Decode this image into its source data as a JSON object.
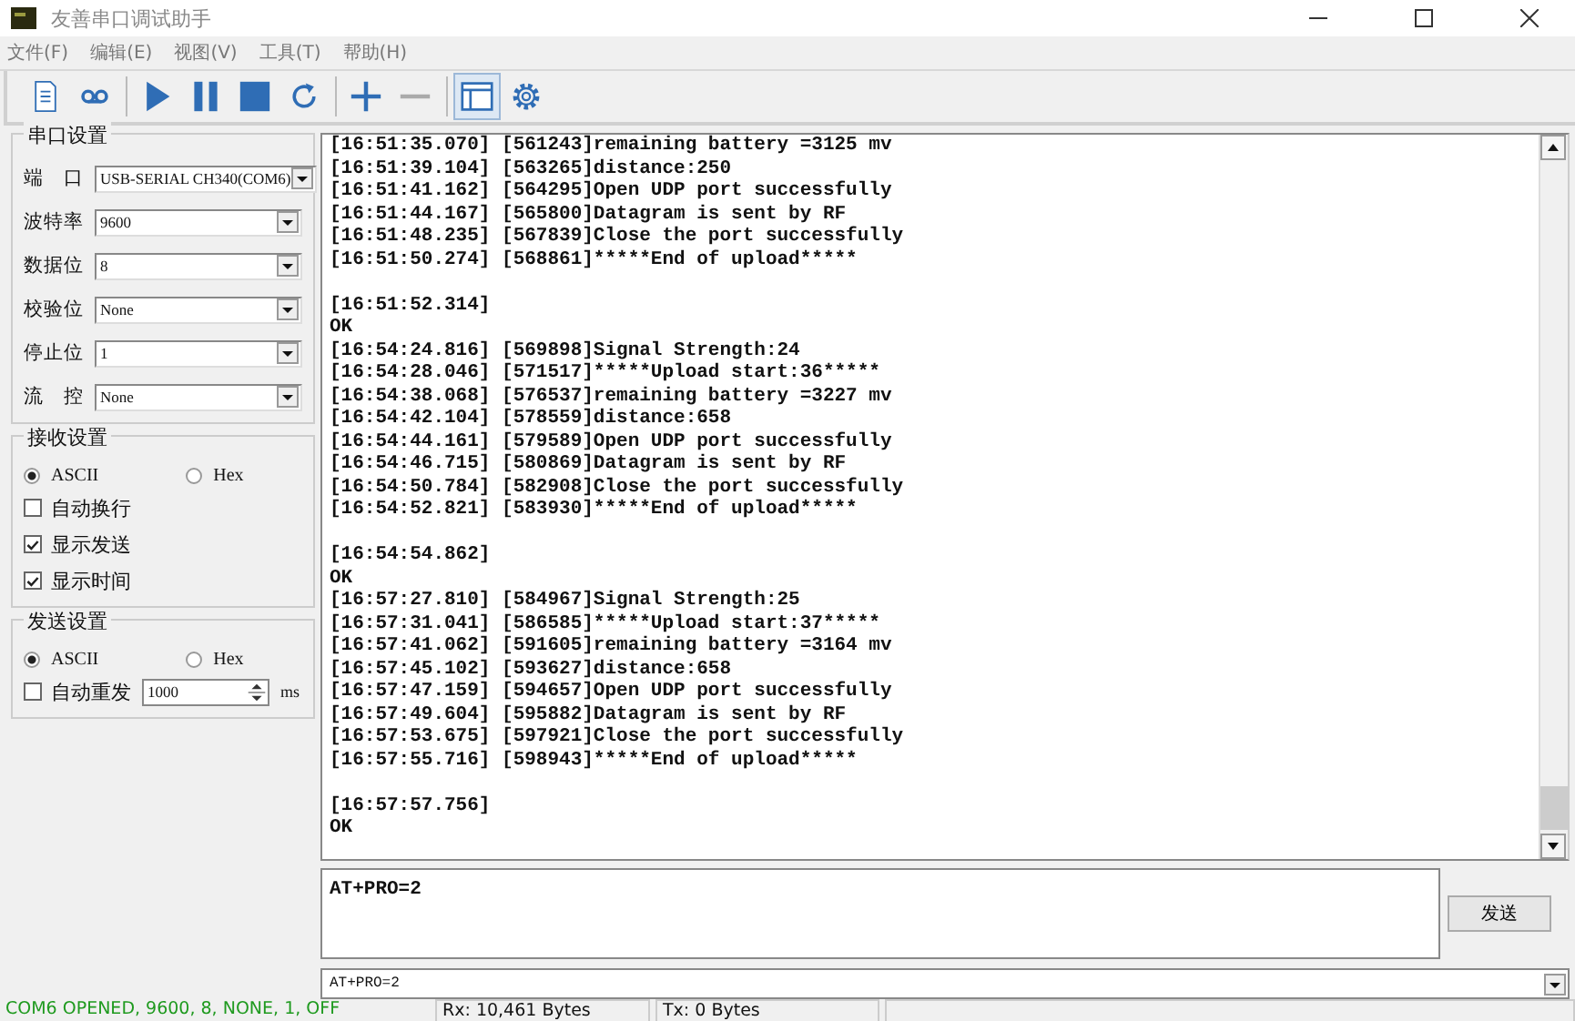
{
  "window": {
    "title": "友善串口调试助手"
  },
  "menu": [
    "文件(F)",
    "编辑(E)",
    "视图(V)",
    "工具(T)",
    "帮助(H)"
  ],
  "toolbar": [
    {
      "kind": "doc",
      "selected": false
    },
    {
      "kind": "tape",
      "selected": false
    },
    {
      "kind": "play",
      "selected": false
    },
    {
      "kind": "pause",
      "selected": false
    },
    {
      "kind": "stop",
      "selected": false
    },
    {
      "kind": "refresh",
      "selected": false
    },
    {
      "kind": "plus",
      "selected": false
    },
    {
      "kind": "minus",
      "selected": false
    },
    {
      "kind": "window",
      "selected": true
    },
    {
      "kind": "gear",
      "selected": false
    }
  ],
  "serial_settings": {
    "title": "串口设置",
    "fields": [
      {
        "label": "端　口",
        "value": "USB-SERIAL CH340(COM6)"
      },
      {
        "label": "波特率",
        "value": "9600"
      },
      {
        "label": "数据位",
        "value": "8"
      },
      {
        "label": "校验位",
        "value": "None"
      },
      {
        "label": "停止位",
        "value": "1"
      },
      {
        "label": "流　控",
        "value": "None"
      }
    ]
  },
  "receive_settings": {
    "title": "接收设置",
    "radios": [
      {
        "label": "ASCII",
        "selected": true
      },
      {
        "label": "Hex",
        "selected": false
      }
    ],
    "checkboxes": [
      {
        "label": "自动换行",
        "checked": false
      },
      {
        "label": "显示发送",
        "checked": true
      },
      {
        "label": "显示时间",
        "checked": true
      }
    ]
  },
  "send_settings": {
    "title": "发送设置",
    "radios": [
      {
        "label": "ASCII",
        "selected": true
      },
      {
        "label": "Hex",
        "selected": false
      }
    ],
    "auto_resend": {
      "label": "自动重发",
      "checked": false,
      "interval": "1000",
      "unit": "ms"
    }
  },
  "log_blocks": [
    [
      "[16:51:35.070] [561243]remaining battery =3125 mv",
      "[16:51:39.104] [563265]distance:250",
      "[16:51:41.162] [564295]Open UDP port successfully",
      "[16:51:44.167] [565800]Datagram is sent by RF",
      "[16:51:48.235] [567839]Close the port successfully",
      "[16:51:50.274] [568861]*****End of upload*****"
    ],
    [
      "[16:51:52.314]",
      "OK",
      "[16:54:24.816] [569898]Signal Strength:24",
      "[16:54:28.046] [571517]*****Upload start:36*****",
      "[16:54:38.068] [576537]remaining battery =3227 mv",
      "[16:54:42.104] [578559]distance:658",
      "[16:54:44.161] [579589]Open UDP port successfully",
      "[16:54:46.715] [580869]Datagram is sent by RF",
      "[16:54:50.784] [582908]Close the port successfully",
      "[16:54:52.821] [583930]*****End of upload*****"
    ],
    [
      "[16:54:54.862]",
      "OK",
      "[16:57:27.810] [584967]Signal Strength:25",
      "[16:57:31.041] [586585]*****Upload start:37*****",
      "[16:57:41.062] [591605]remaining battery =3164 mv",
      "[16:57:45.102] [593627]distance:658",
      "[16:57:47.159] [594657]Open UDP port successfully",
      "[16:57:49.604] [595882]Datagram is sent by RF",
      "[16:57:53.675] [597921]Close the port successfully",
      "[16:57:55.716] [598943]*****End of upload*****"
    ],
    [
      "[16:57:57.756]",
      "OK"
    ]
  ],
  "send_box": {
    "value": "AT+PRO=2"
  },
  "send_button": "发送",
  "history": {
    "value": "AT+PRO=2"
  },
  "status_bar": {
    "connection": "COM6 OPENED, 9600, 8, NONE, 1, OFF",
    "rx": "Rx: 10,461 Bytes",
    "tx": "Tx: 0 Bytes"
  }
}
